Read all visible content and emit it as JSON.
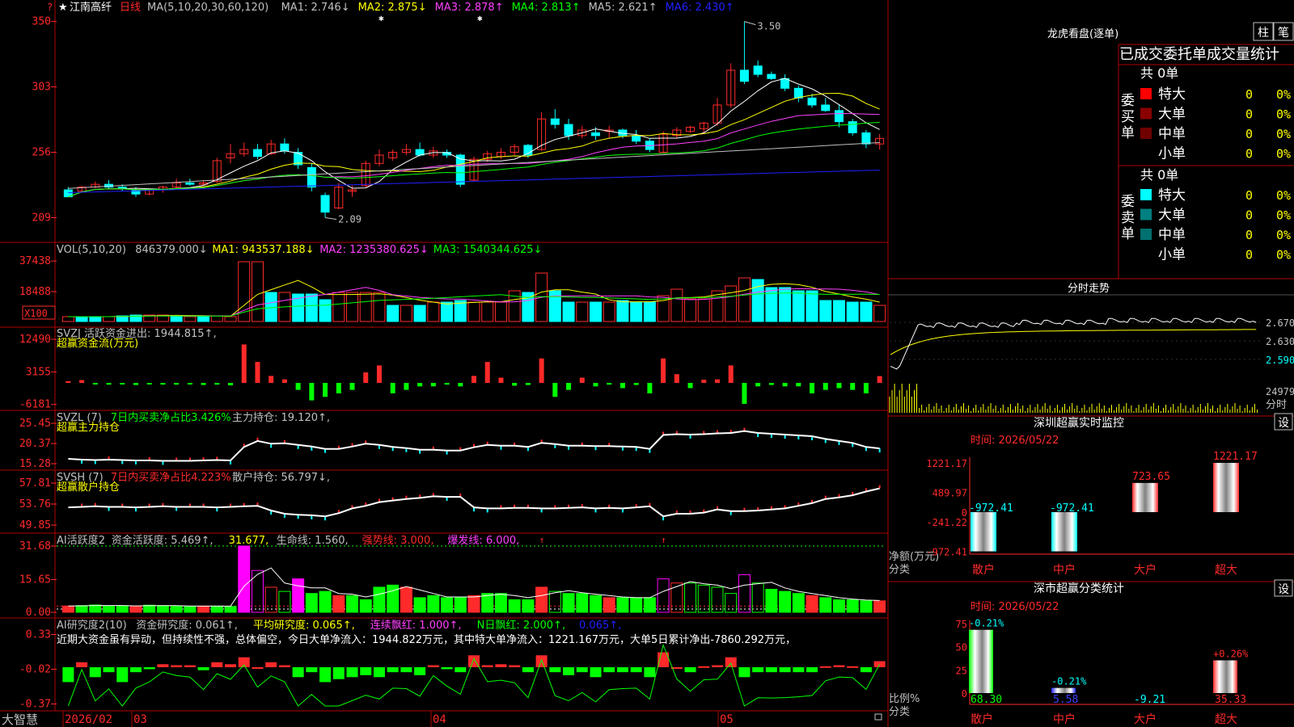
{
  "stock": {
    "name": "江南高纤",
    "period": "日线",
    "star": "★"
  },
  "colors": {
    "up": "#ff2a2a",
    "down": "#00ffff",
    "green": "#00ff00",
    "frame": "#b00000",
    "ma1": "#ffffff",
    "ma2": "#ffff00",
    "ma3": "#ff40ff",
    "ma4": "#00ff00",
    "ma5": "#c0c0c0",
    "ma6": "#2020ff"
  },
  "price_panel": {
    "legend": [
      {
        "text": "MA(5,10,20,30,60,120)",
        "color": "#c0c0c0"
      },
      {
        "text": "MA1: 2.746↓",
        "color": "#c0c0c0"
      },
      {
        "text": "MA2: 2.875↓",
        "color": "#ffff00"
      },
      {
        "text": "MA3: 2.878↑",
        "color": "#ff40ff"
      },
      {
        "text": "MA4: 2.813↑",
        "color": "#00ff00"
      },
      {
        "text": "MA5: 2.621↑",
        "color": "#c0c0c0"
      },
      {
        "text": "MA6: 2.430↑",
        "color": "#2020ff"
      }
    ],
    "ticks": [
      "350",
      "303",
      "256",
      "209"
    ],
    "high_label": "3.50",
    "low_label": "2.09"
  },
  "vol_panel": {
    "legend": [
      {
        "text": "VOL(5,10,20)",
        "color": "#c0c0c0"
      },
      {
        "text": "846379.000↓",
        "color": "#c0c0c0"
      },
      {
        "text": "MA1: 943537.188↓",
        "color": "#ffff00"
      },
      {
        "text": "MA2: 1235380.625↓",
        "color": "#ff40ff"
      },
      {
        "text": "MA3: 1540344.625↓",
        "color": "#00ff00"
      }
    ],
    "ticks": [
      "37438",
      "18488"
    ],
    "unit": "X100"
  },
  "svzj_panel": {
    "line1": [
      {
        "text": "SVZJ  活跃资金进出: 1944.815↑,",
        "color": "#c0c0c0"
      }
    ],
    "line2": "超赢资金流(万元)",
    "ticks": [
      "12490",
      "3155",
      "-6181"
    ]
  },
  "svzl_panel": {
    "line1": [
      {
        "text": "SVZL (7)",
        "color": "#c0c0c0"
      },
      {
        "text": "7日内买卖净占比3.426%",
        "color": "#00ff00"
      },
      {
        "text": "主力持仓: 19.120↑,",
        "color": "#c0c0c0"
      }
    ],
    "line2": "超赢主力持仓",
    "ticks": [
      "25.45",
      "20.37",
      "15.28"
    ]
  },
  "svsh_panel": {
    "line1": [
      {
        "text": "SVSH (7)",
        "color": "#c0c0c0"
      },
      {
        "text": "7日内买卖净占比4.223%",
        "color": "#ff2a2a"
      },
      {
        "text": "散户持仓: 56.797↓,",
        "color": "#c0c0c0"
      }
    ],
    "line2": "超赢散户持仓",
    "ticks": [
      "57.81",
      "53.76",
      "49.85"
    ]
  },
  "ai_active_panel": {
    "line1": [
      {
        "text": "AI活跃度2",
        "color": "#c0c0c0"
      },
      {
        "text": "资金活跃度: 5.469↑,",
        "color": "#c0c0c0"
      },
      {
        "text": "31.677,",
        "color": "#ffff00"
      },
      {
        "text": "生命线: 1.560,",
        "color": "#c0c0c0"
      },
      {
        "text": "强势线: 3.000,",
        "color": "#ff2a2a"
      },
      {
        "text": "爆发线: 6.000,",
        "color": "#ff40ff"
      }
    ],
    "ticks": [
      "31.68",
      "15.65",
      "0.00"
    ]
  },
  "ai_research_panel": {
    "line1": [
      {
        "text": "AI研究度2(10)",
        "color": "#c0c0c0"
      },
      {
        "text": "资金研究度: 0.061↑,",
        "color": "#c0c0c0"
      },
      {
        "text": "平均研究度: 0.065↑,",
        "color": "#ffff00"
      },
      {
        "text": "连续飘红: 1.000↑,",
        "color": "#ff40ff"
      },
      {
        "text": "N日飘红: 2.000↑,",
        "color": "#00ff00"
      },
      {
        "text": "0.065↑,",
        "color": "#2020ff"
      }
    ],
    "comment": "近期大资金虽有异动，但持续性不强，总体偏空，今日大单净流入：1944.822万元，其中特大单净流入：1221.167万元，大单5日累计净出-7860.292万元，",
    "ticks": [
      "0.33",
      "-0.02",
      "-0.37"
    ]
  },
  "date_axis": {
    "brand": "大智慧",
    "labels": [
      "2026/02",
      "03",
      "04",
      "05"
    ]
  },
  "dragon_tiger": {
    "title": "龙虎看盘(逐单)",
    "btn1": "柱",
    "btn2": "笔",
    "header": "已成交委托单成交量统计",
    "buy_label": "委买单",
    "sell_label": "委卖单",
    "buy_total": "共 0单",
    "sell_total": "共 0单",
    "buy_rows": [
      {
        "label": "特大",
        "count": "0",
        "pct": "0%",
        "color": "#ff0000"
      },
      {
        "label": "大单",
        "count": "0",
        "pct": "0%",
        "color": "#8b0000"
      },
      {
        "label": "中单",
        "count": "0",
        "pct": "0%",
        "color": "#700000"
      },
      {
        "label": "小单",
        "count": "0",
        "pct": "0%",
        "color": "#000000"
      }
    ],
    "sell_rows": [
      {
        "label": "特大",
        "count": "0",
        "pct": "0%",
        "color": "#00ffff"
      },
      {
        "label": "大单",
        "count": "0",
        "pct": "0%",
        "color": "#008080"
      },
      {
        "label": "中单",
        "count": "0",
        "pct": "0%",
        "color": "#007070"
      },
      {
        "label": "小单",
        "count": "0",
        "pct": "0%",
        "color": "#000000"
      }
    ]
  },
  "intraday": {
    "title": "分时走势",
    "ticks": [
      "2.670",
      "2.630",
      "2.590"
    ],
    "vol_tick": "24979",
    "vol_label": "分时"
  },
  "realtime_monitor": {
    "title": "深圳超赢实时监控",
    "set_btn": "设",
    "time": "时间: 2026/05/22",
    "ylabel_line1": "净额(万元)",
    "ylabel_line2": "分类",
    "ticks": [
      "1221.17",
      "489.97",
      "0",
      "-241.22",
      "-972.41"
    ]
  },
  "class_stats": {
    "title": "深市超赢分类统计",
    "set_btn": "设",
    "time": "时间: 2026/05/22",
    "ylabel_line1": "比例%",
    "ylabel_line2": "分类",
    "ticks": [
      "75",
      "50",
      "25",
      "0"
    ]
  },
  "chart_data": [
    {
      "type": "candlestick",
      "title": "江南高纤 日线",
      "ylim": [
        2.0,
        3.55
      ],
      "x": [
        "2026/02",
        "03",
        "04",
        "05"
      ],
      "ohlc": [
        [
          2.29,
          2.31,
          2.26,
          2.24
        ],
        [
          2.28,
          2.32,
          2.27,
          2.31
        ],
        [
          2.31,
          2.35,
          2.3,
          2.33
        ],
        [
          2.33,
          2.36,
          2.3,
          2.31
        ],
        [
          2.31,
          2.33,
          2.28,
          2.3
        ],
        [
          2.29,
          2.31,
          2.24,
          2.26
        ],
        [
          2.26,
          2.3,
          2.25,
          2.29
        ],
        [
          2.29,
          2.32,
          2.27,
          2.31
        ],
        [
          2.31,
          2.37,
          2.3,
          2.34
        ],
        [
          2.34,
          2.37,
          2.32,
          2.33
        ],
        [
          2.33,
          2.36,
          2.32,
          2.34
        ],
        [
          2.35,
          2.52,
          2.34,
          2.5
        ],
        [
          2.52,
          2.62,
          2.48,
          2.55
        ],
        [
          2.55,
          2.63,
          2.53,
          2.58
        ],
        [
          2.58,
          2.62,
          2.51,
          2.53
        ],
        [
          2.55,
          2.65,
          2.54,
          2.62
        ],
        [
          2.62,
          2.66,
          2.55,
          2.57
        ],
        [
          2.56,
          2.59,
          2.44,
          2.47
        ],
        [
          2.45,
          2.48,
          2.28,
          2.31
        ],
        [
          2.25,
          2.27,
          2.09,
          2.13
        ],
        [
          2.16,
          2.34,
          2.15,
          2.31
        ],
        [
          2.28,
          2.32,
          2.24,
          2.29
        ],
        [
          2.32,
          2.5,
          2.31,
          2.48
        ],
        [
          2.48,
          2.58,
          2.46,
          2.54
        ],
        [
          2.52,
          2.58,
          2.5,
          2.56
        ],
        [
          2.56,
          2.62,
          2.54,
          2.58
        ],
        [
          2.58,
          2.63,
          2.53,
          2.54
        ],
        [
          2.54,
          2.6,
          2.52,
          2.57
        ],
        [
          2.56,
          2.58,
          2.52,
          2.54
        ],
        [
          2.54,
          2.55,
          2.31,
          2.33
        ],
        [
          2.36,
          2.53,
          2.35,
          2.51
        ],
        [
          2.51,
          2.57,
          2.49,
          2.55
        ],
        [
          2.53,
          2.59,
          2.51,
          2.56
        ],
        [
          2.56,
          2.62,
          2.54,
          2.6
        ],
        [
          2.61,
          2.62,
          2.52,
          2.54
        ],
        [
          2.58,
          2.85,
          2.57,
          2.8
        ],
        [
          2.8,
          2.87,
          2.73,
          2.76
        ],
        [
          2.76,
          2.8,
          2.65,
          2.68
        ],
        [
          2.68,
          2.75,
          2.66,
          2.72
        ],
        [
          2.7,
          2.74,
          2.65,
          2.68
        ],
        [
          2.71,
          2.75,
          2.66,
          2.72
        ],
        [
          2.72,
          2.73,
          2.66,
          2.68
        ],
        [
          2.68,
          2.72,
          2.62,
          2.64
        ],
        [
          2.64,
          2.66,
          2.56,
          2.58
        ],
        [
          2.56,
          2.71,
          2.55,
          2.69
        ],
        [
          2.68,
          2.74,
          2.66,
          2.72
        ],
        [
          2.71,
          2.75,
          2.7,
          2.74
        ],
        [
          2.73,
          2.78,
          2.7,
          2.77
        ],
        [
          2.77,
          2.95,
          2.75,
          2.9
        ],
        [
          2.9,
          3.2,
          2.88,
          3.15
        ],
        [
          3.15,
          3.5,
          3.05,
          3.07
        ],
        [
          3.18,
          3.22,
          3.1,
          3.12
        ],
        [
          3.12,
          3.14,
          3.08,
          3.09
        ],
        [
          3.09,
          3.12,
          3.0,
          3.02
        ],
        [
          3.02,
          3.04,
          2.92,
          2.95
        ],
        [
          2.95,
          2.98,
          2.88,
          2.9
        ],
        [
          2.9,
          2.95,
          2.85,
          2.86
        ],
        [
          2.86,
          2.9,
          2.74,
          2.78
        ],
        [
          2.78,
          2.8,
          2.68,
          2.7
        ],
        [
          2.7,
          2.72,
          2.59,
          2.62
        ],
        [
          2.62,
          2.69,
          2.58,
          2.66
        ]
      ]
    },
    {
      "type": "bar",
      "title": "VOL(5,10,20)",
      "unit": "X100",
      "ylim": [
        0,
        40000
      ],
      "values": [
        3000,
        3000,
        3000,
        3000,
        3500,
        4000,
        4000,
        4000,
        3500,
        3000,
        3500,
        3500,
        3000,
        37000,
        37000,
        18000,
        18000,
        17000,
        17000,
        13500,
        18000,
        18000,
        18000,
        18000,
        10000,
        10000,
        10000,
        12000,
        12000,
        13000,
        12000,
        12000,
        12000,
        19000,
        18000,
        30000,
        19000,
        12000,
        12000,
        12000,
        12000,
        13000,
        12000,
        12000,
        16000,
        20000,
        14000,
        14000,
        19000,
        22000,
        27000,
        26000,
        21000,
        21000,
        19000,
        19000,
        13000,
        13000,
        12000,
        12000,
        10000
      ],
      "up": [
        1,
        0,
        0,
        1,
        0,
        0,
        1,
        1,
        0,
        1,
        0,
        1,
        1,
        1,
        1,
        0,
        1,
        0,
        0,
        0,
        1,
        1,
        1,
        1,
        0,
        1,
        0,
        1,
        0,
        0,
        1,
        1,
        1,
        1,
        0,
        1,
        0,
        0,
        1,
        0,
        1,
        0,
        0,
        0,
        1,
        1,
        1,
        1,
        1,
        1,
        1,
        0,
        0,
        0,
        0,
        0,
        0,
        0,
        0,
        0,
        1
      ]
    },
    {
      "type": "bar",
      "title": "SVZJ 超赢资金流(万元)",
      "ylim": [
        -6181,
        12490
      ],
      "values": [
        500,
        800,
        -300,
        -500,
        -400,
        -600,
        -300,
        -500,
        -500,
        -400,
        -600,
        -500,
        -700,
        11000,
        6000,
        2000,
        1000,
        -2000,
        -5000,
        -4000,
        -3000,
        -2000,
        3000,
        5000,
        -3000,
        -2000,
        -1000,
        -1000,
        -500,
        -1000,
        2000,
        6000,
        1500,
        -800,
        -600,
        7000,
        -4000,
        -2000,
        1500,
        -1000,
        -500,
        -1500,
        -600,
        -3000,
        7000,
        2500,
        -1500,
        900,
        1000,
        5000,
        -6000,
        -1000,
        -600,
        -1000,
        -1000,
        -3000,
        -2000,
        -1500,
        -2000,
        -3000,
        1944.815
      ]
    },
    {
      "type": "line",
      "title": "SVZL 超赢主力持仓",
      "ylim": [
        15.28,
        25.45
      ],
      "values": [
        16.5,
        16.3,
        16.2,
        16.3,
        16.2,
        16.1,
        16.1,
        16.0,
        16.0,
        16.0,
        16.1,
        16.2,
        16.1,
        19.5,
        21.0,
        20.3,
        20.4,
        20.0,
        19.6,
        19.0,
        19.0,
        19.6,
        20.3,
        20.0,
        19.5,
        19.2,
        18.8,
        18.8,
        18.6,
        18.6,
        19.4,
        20.0,
        19.8,
        19.8,
        19.5,
        20.5,
        20.2,
        19.8,
        19.8,
        19.7,
        19.7,
        19.6,
        19.5,
        19.0,
        22.5,
        22.7,
        22.6,
        22.7,
        22.9,
        23.0,
        23.5,
        23.0,
        22.8,
        22.6,
        22.4,
        22.2,
        21.5,
        21.0,
        20.5,
        19.5,
        19.12
      ]
    },
    {
      "type": "line",
      "title": "SVSH 超赢散户持仓",
      "ylim": [
        49.85,
        57.81
      ],
      "values": [
        53.2,
        53.3,
        53.4,
        53.3,
        53.3,
        53.2,
        53.3,
        53.4,
        53.3,
        53.3,
        53.3,
        53.2,
        53.3,
        53.4,
        53.5,
        52.6,
        52.0,
        51.8,
        51.7,
        51.5,
        52.1,
        53.0,
        53.5,
        54.2,
        54.5,
        54.8,
        55.0,
        55.3,
        55.2,
        55.2,
        53.2,
        53.0,
        53.0,
        53.1,
        53.1,
        53.0,
        53.0,
        53.1,
        53.2,
        53.0,
        53.1,
        53.0,
        53.2,
        53.4,
        51.5,
        52.0,
        52.0,
        52.2,
        52.8,
        52.5,
        52.5,
        52.6,
        52.8,
        53.0,
        53.5,
        54.0,
        54.8,
        55.1,
        55.5,
        56.2,
        56.797
      ]
    },
    {
      "type": "bar",
      "title": "AI活跃度2",
      "ylim": [
        0,
        31.68
      ],
      "values": [
        3,
        3.2,
        3.5,
        3.0,
        3.2,
        3.0,
        3.4,
        3.2,
        3.0,
        2.8,
        3.0,
        3.0,
        2.8,
        31.68,
        20,
        12,
        10,
        16,
        9,
        10,
        8,
        8,
        6,
        12,
        13,
        12,
        7,
        8,
        7,
        7,
        8,
        9,
        9,
        6,
        6,
        12,
        10,
        9,
        9,
        8,
        7,
        7,
        7,
        7,
        16,
        14,
        14,
        13,
        12,
        9,
        18,
        14,
        11,
        10,
        9,
        8,
        7,
        6,
        6,
        5.5,
        5.469
      ]
    },
    {
      "type": "bar",
      "title": "AI研究度2(10)",
      "ylim": [
        -0.37,
        0.33
      ],
      "values": [
        -0.15,
        0.05,
        -0.1,
        -0.05,
        -0.15,
        -0.05,
        -0.02,
        0.03,
        0.02,
        0.02,
        -0.03,
        0.05,
        0.03,
        0.1,
        0.0,
        0.05,
        0.02,
        -0.1,
        -0.05,
        -0.15,
        -0.12,
        -0.1,
        -0.08,
        -0.1,
        -0.05,
        -0.05,
        -0.08,
        0.02,
        -0.02,
        -0.05,
        0.12,
        0.02,
        0.03,
        0.02,
        -0.05,
        0.12,
        -0.05,
        -0.08,
        -0.05,
        -0.1,
        -0.05,
        -0.05,
        -0.05,
        -0.1,
        0.15,
        0.0,
        -0.05,
        0.01,
        0.02,
        0.1,
        -0.1,
        -0.05,
        -0.05,
        -0.05,
        -0.05,
        -0.05,
        0.01,
        0.02,
        0.01,
        -0.05,
        0.061
      ]
    },
    {
      "type": "bar",
      "title": "深圳超赢实时监控",
      "categories": [
        "散户",
        "中户",
        "大户",
        "超大"
      ],
      "values": [
        -972.41,
        -972.41,
        723.65,
        1221.17
      ],
      "labels": [
        "-972.41",
        "-972.41",
        "723.65",
        "1221.17"
      ],
      "ylim": [
        -972.41,
        1221.17
      ]
    },
    {
      "type": "bar",
      "title": "深市超赢分类统计",
      "categories": [
        "散户",
        "中户",
        "大户",
        "超大"
      ],
      "values": [
        68.3,
        5.58,
        -9.21,
        35.33
      ],
      "changes": [
        "-0.21%",
        "-0.21%",
        "",
        "+0.26%"
      ],
      "bottom_labels": [
        "68.30",
        "5.58",
        "-9.21",
        "35.33"
      ],
      "ylim": [
        0,
        75
      ]
    }
  ]
}
